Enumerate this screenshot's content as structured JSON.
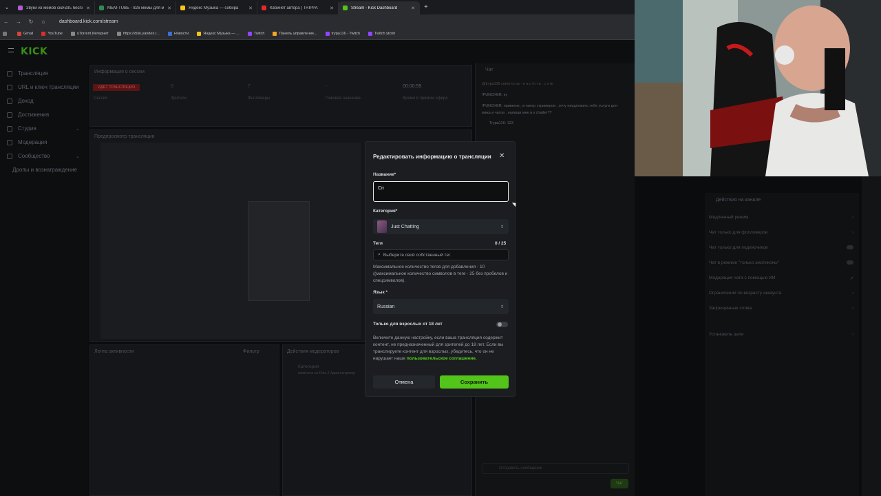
{
  "browser": {
    "tabs": [
      {
        "title": "Звуки из мемов скачать бесплатно",
        "favicon_color": "#b45cd6",
        "active": false
      },
      {
        "title": "MEM-TUBE - 826 мемы для м",
        "favicon_color": "#2e8b57",
        "active": false
      },
      {
        "title": "Яндекс Музыка — собира",
        "favicon_color": "#f5c518",
        "active": false
      },
      {
        "title": "Кабинет автора | TRIPPA",
        "favicon_color": "#e02b2b",
        "active": false
      },
      {
        "title": "Stream - Kick Dashboard",
        "favicon_color": "#53c41a",
        "active": true
      }
    ],
    "url": "dashboard.kick.com/stream",
    "bookmarks": [
      {
        "label": "Gmail",
        "color": "#d44638"
      },
      {
        "label": "YouTube",
        "color": "#e02b2b"
      },
      {
        "label": "uTorrent Интернет",
        "color": "#888888"
      },
      {
        "label": "https://disk.yandex.r...",
        "color": "#888888"
      },
      {
        "label": "Новости",
        "color": "#3b6fd6"
      },
      {
        "label": "Яндекс Музыка — ...",
        "color": "#f5c518"
      },
      {
        "label": "Twitch",
        "color": "#9146ff"
      },
      {
        "label": "Панель управление...",
        "color": "#f5a623"
      },
      {
        "label": "trypa116 - Twitch",
        "color": "#9146ff"
      },
      {
        "label": "Twitch ytcnh",
        "color": "#9146ff"
      }
    ]
  },
  "app": {
    "logo": "KICK",
    "sidebar": [
      {
        "label": "Трансляция",
        "chevron": false
      },
      {
        "label": "URL и ключ трансляции",
        "chevron": false
      },
      {
        "label": "Доход",
        "chevron": false
      },
      {
        "label": "Достижения",
        "chevron": false
      },
      {
        "label": "Студия",
        "chevron": true
      },
      {
        "label": "Модерация",
        "chevron": false
      },
      {
        "label": "Сообщество",
        "chevron": true
      },
      {
        "label": "Дропы и вознаграждение",
        "chevron": false
      }
    ],
    "session": {
      "title": "Информация о сессии",
      "live_badge": "ИДЁТ ТРАНСЛЯЦИЯ",
      "stats": [
        {
          "value": "0",
          "label": "Зрители"
        },
        {
          "value": "7",
          "label": "Фолловеры"
        },
        {
          "value": "-",
          "label": "Пиковое значение"
        },
        {
          "value": "00:00:59",
          "label": "Время в прямом эфире"
        }
      ],
      "session_label": "Сессия"
    },
    "preview": {
      "title": "Предпросмотр трансляции"
    },
    "activity": {
      "title": "Лента активности",
      "filter": "Фильтр"
    },
    "mod_actions": {
      "title": "Действия модераторов",
      "item_title": "Категория",
      "item_sub": "изменено на Dota 2 Администратор"
    },
    "chat": {
      "title": "Чат",
      "lines": [
        "@trypa116 come to us - n a c h n a . c o m",
        "!PUNCHER: ку",
        "!PUNCHER: приветик , в натер стримеров , хочу предложить тебе услуги для",
        "вижа и чатов , напиши мне в к chatter??",
        "Trypa116: 123"
      ],
      "input_placeholder": "Отправить сообщение",
      "send_label": "Чат"
    },
    "channel_actions": {
      "title": "Действия на канале",
      "items": [
        {
          "label": "Медленный режим",
          "control": "chevron"
        },
        {
          "label": "Чат только для фолловеров",
          "control": "chevron"
        },
        {
          "label": "Чат только для подписчиков",
          "control": "toggle"
        },
        {
          "label": "Чат в режиме \"только эмотиконы\"",
          "control": "toggle"
        },
        {
          "label": "Модерация чата с помощью ИИ",
          "control": "link"
        },
        {
          "label": "Ограничения по возрасту аккаунта",
          "control": "chevron"
        },
        {
          "label": "Запрещенные слова",
          "control": "chevron"
        },
        {
          "label": "Установить цели",
          "control": "chevron"
        }
      ]
    }
  },
  "modal": {
    "title": "Редактировать информацию о трансляции",
    "name_label": "Название*",
    "name_value": "Сп",
    "category_label": "Категория*",
    "category_value": "Just Chatting",
    "tags_label": "Теги",
    "tags_count": "0 / 25",
    "tags_placeholder": "Выберите свой собственный тег",
    "tags_help": "Максимальное количество тегов для добавления - 10 ((максимальное количество символов в теге - 25 без пробелов и спецсимволов).",
    "language_label": "Язык *",
    "language_value": "Russian",
    "adult_label": "Только для взрослых от 18 лет",
    "adult_enabled": false,
    "adult_help": "Включите данную настройку, если ваша трансляция содержит контент, не предназначенный для зрителей до 18 лет. Если вы транслируете контент для взрослых, убедитесь, что он не нарушает наше",
    "adult_link": "пользовательское соглашение.",
    "cancel_label": "Отмена",
    "save_label": "Сохранить"
  },
  "colors": {
    "accent": "#53c41a",
    "background": "#0b0c0e",
    "modal_bg": "#1b1d21"
  }
}
